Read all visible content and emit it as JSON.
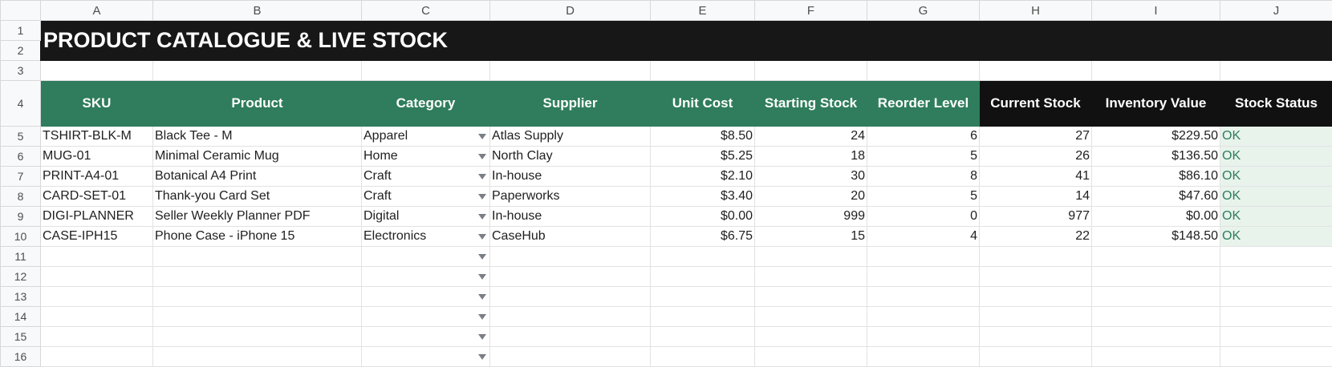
{
  "columns": [
    "A",
    "B",
    "C",
    "D",
    "E",
    "F",
    "G",
    "H",
    "I",
    "J"
  ],
  "row_numbers": [
    "1",
    "2",
    "3",
    "4",
    "5",
    "6",
    "7",
    "8",
    "9",
    "10",
    "11",
    "12",
    "13",
    "14",
    "15",
    "16"
  ],
  "title": "PRODUCT CATALOGUE & LIVE STOCK",
  "headers": [
    "SKU",
    "Product",
    "Category",
    "Supplier",
    "Unit Cost",
    "Starting Stock",
    "Reorder Level",
    "Current Stock",
    "Inventory Value",
    "Stock Status"
  ],
  "rows": [
    [
      "TSHIRT-BLK-M",
      "Black Tee - M",
      "Apparel",
      "Atlas Supply",
      "$8.50",
      "24",
      "6",
      "27",
      "$229.50",
      "OK"
    ],
    [
      "MUG-01",
      "Minimal Ceramic Mug",
      "Home",
      "North Clay",
      "$5.25",
      "18",
      "5",
      "26",
      "$136.50",
      "OK"
    ],
    [
      "PRINT-A4-01",
      "Botanical A4 Print",
      "Craft",
      "In-house",
      "$2.10",
      "30",
      "8",
      "41",
      "$86.10",
      "OK"
    ],
    [
      "CARD-SET-01",
      "Thank-you Card Set",
      "Craft",
      "Paperworks",
      "$3.40",
      "20",
      "5",
      "14",
      "$47.60",
      "OK"
    ],
    [
      "DIGI-PLANNER",
      "Seller Weekly Planner PDF",
      "Digital",
      "In-house",
      "$0.00",
      "999",
      "0",
      "977",
      "$0.00",
      "OK"
    ],
    [
      "CASE-IPH15",
      "Phone Case - iPhone 15",
      "Electronics",
      "CaseHub",
      "$6.75",
      "15",
      "4",
      "22",
      "$148.50",
      "OK"
    ]
  ],
  "colors": {
    "title_bg": "#171717",
    "header_green": "#2f7d5c",
    "header_black": "#111111",
    "status_bg": "#e8f3ec",
    "status_text": "#2f7d5c"
  },
  "icons": {
    "dropdown": "chevron-down-icon"
  }
}
